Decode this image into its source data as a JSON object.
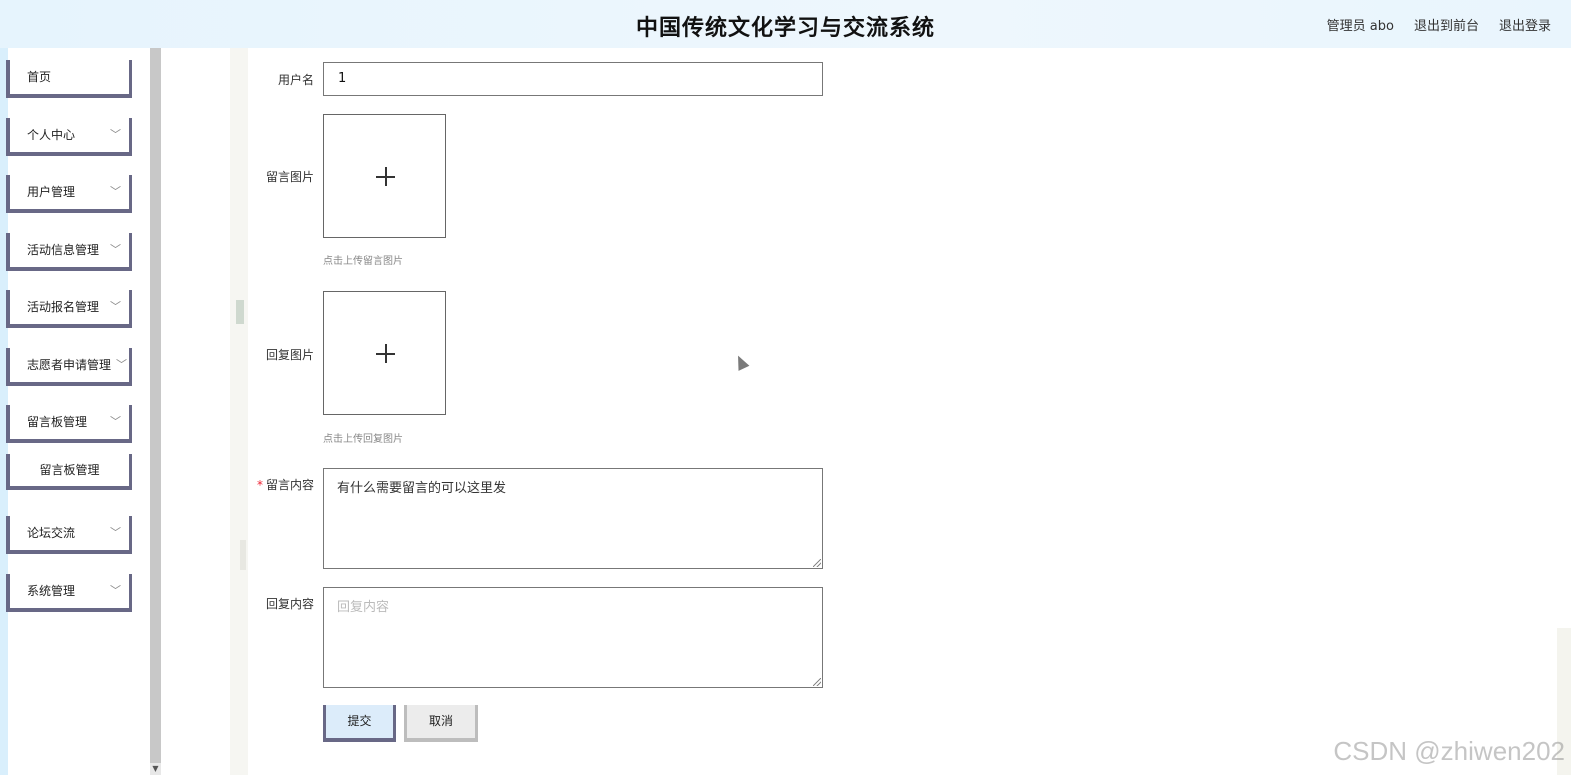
{
  "header": {
    "title": "中国传统文化学习与交流系统",
    "user": "管理员 abo",
    "back_front": "退出到前台",
    "logout": "退出登录"
  },
  "sidebar": {
    "items": [
      {
        "label": "首页",
        "has_chevron": false
      },
      {
        "label": "个人中心",
        "has_chevron": true
      },
      {
        "label": "用户管理",
        "has_chevron": true
      },
      {
        "label": "活动信息管理",
        "has_chevron": true
      },
      {
        "label": "活动报名管理",
        "has_chevron": true
      },
      {
        "label": "志愿者申请管理",
        "has_chevron": true
      },
      {
        "label": "留言板管理",
        "has_chevron": true
      },
      {
        "label": "留言板管理",
        "sub": true
      },
      {
        "label": "论坛交流",
        "has_chevron": true
      },
      {
        "label": "系统管理",
        "has_chevron": true
      }
    ],
    "chevron": "﹀"
  },
  "form": {
    "username_label": "用户名",
    "username_value": "1",
    "message_image_label": "留言图片",
    "message_image_hint": "点击上传留言图片",
    "reply_image_label": "回复图片",
    "reply_image_hint": "点击上传回复图片",
    "required_mark": "*",
    "message_content_label": "留言内容",
    "message_content_value": "有什么需要留言的可以这里发",
    "reply_content_label": "回复内容",
    "reply_content_placeholder": "回复内容",
    "submit_label": "提交",
    "cancel_label": "取消"
  },
  "watermark": "CSDN @zhiwen202"
}
